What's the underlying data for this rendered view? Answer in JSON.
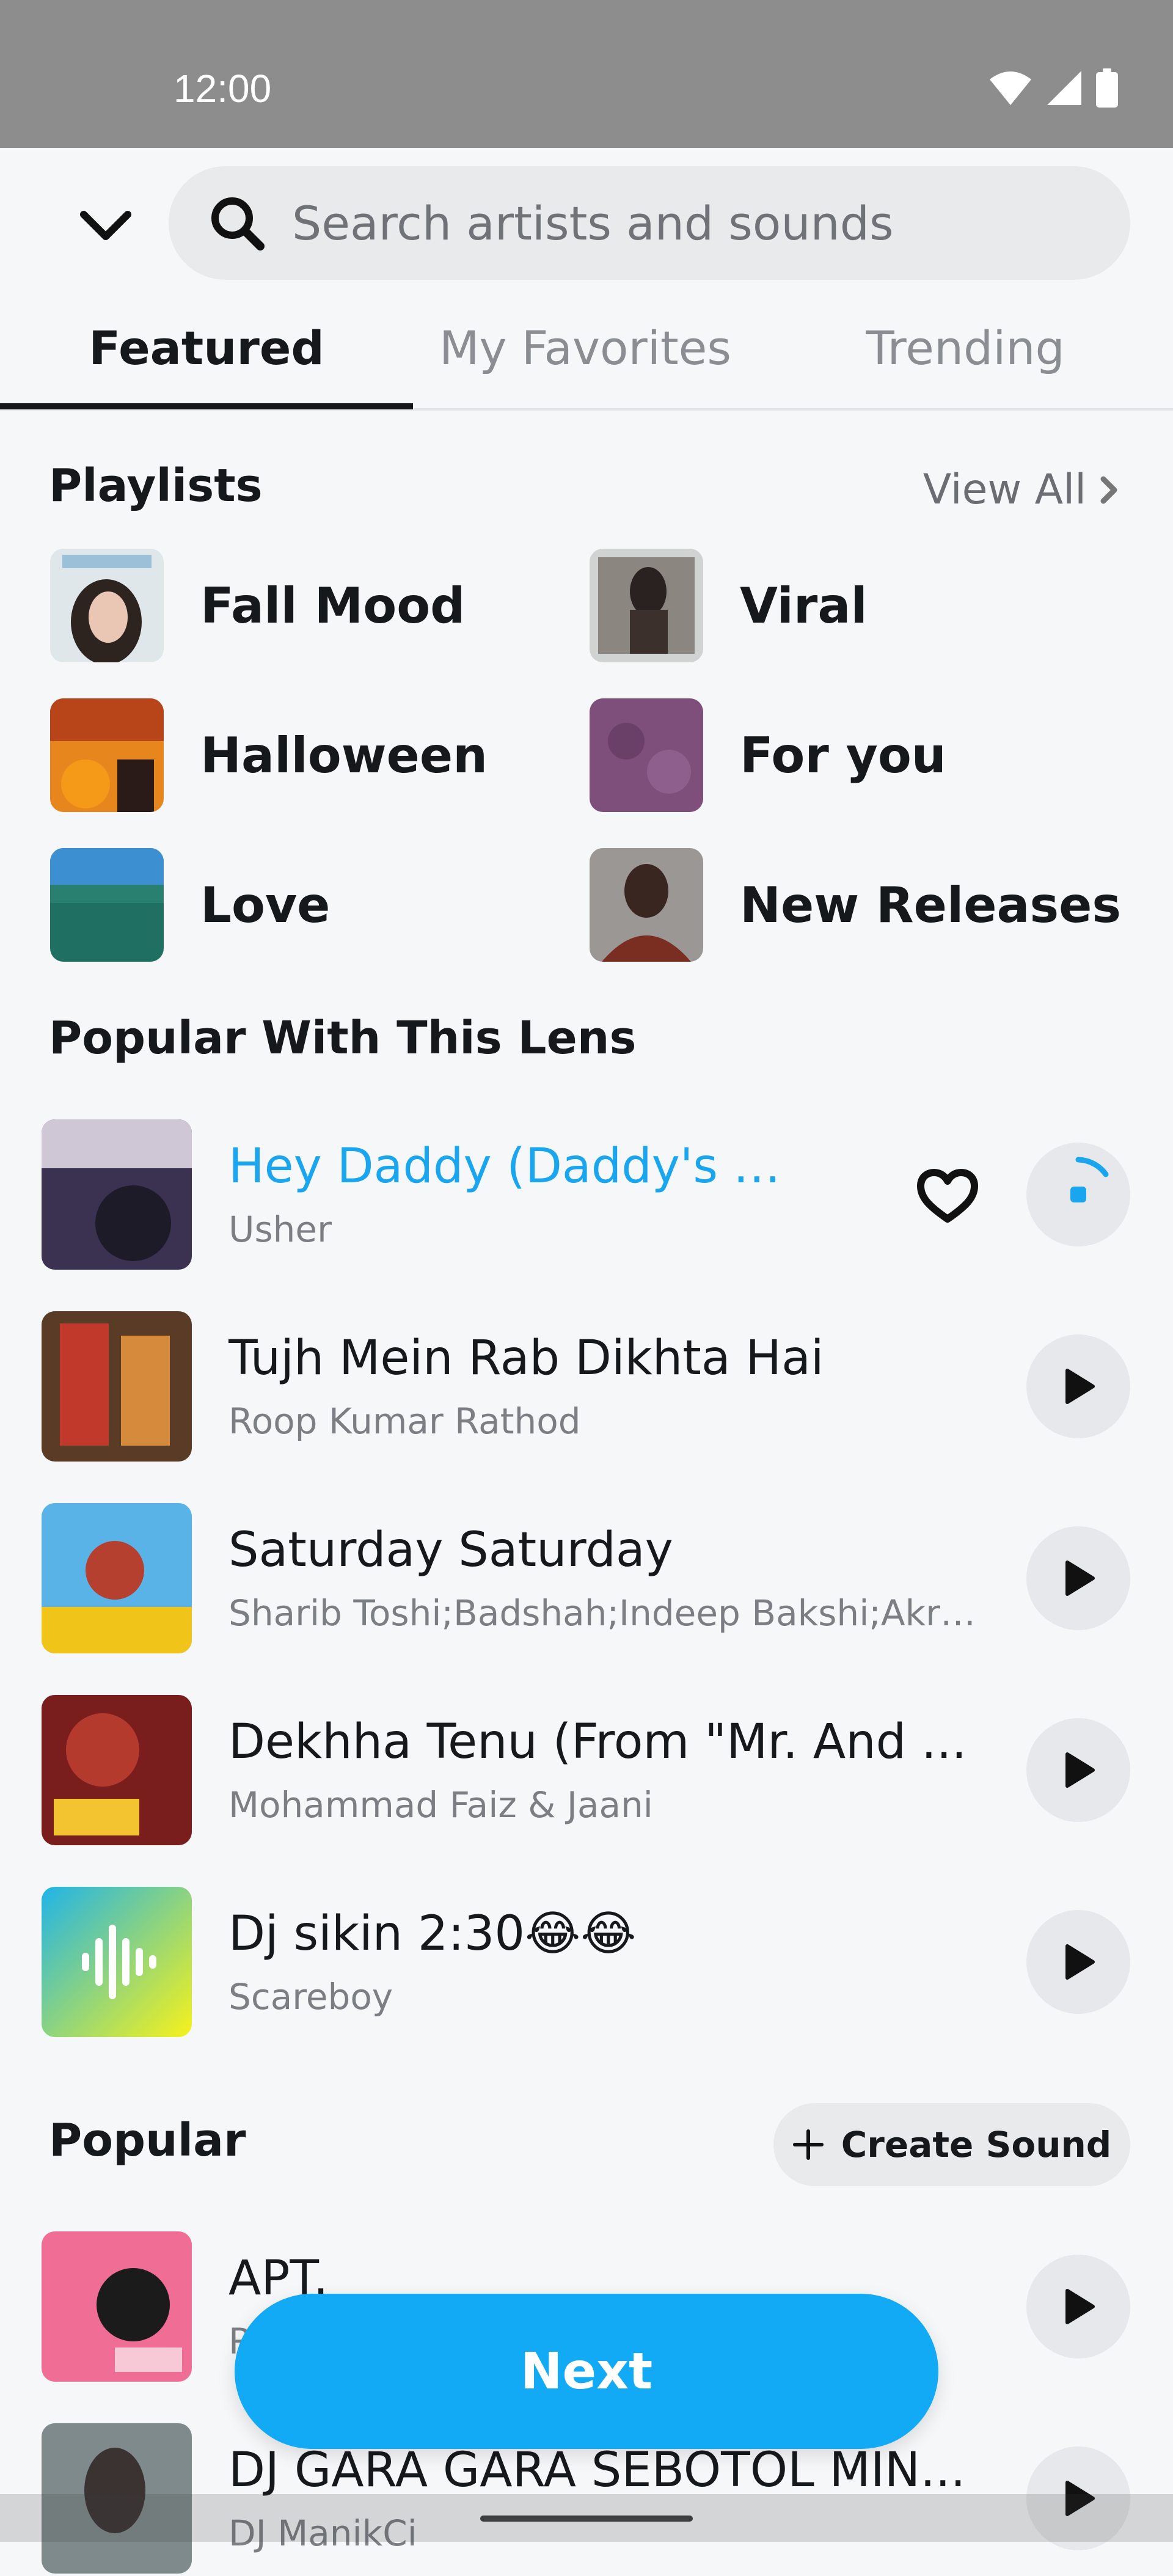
{
  "status_bar": {
    "time": "12:00"
  },
  "search": {
    "placeholder": "Search artists and sounds"
  },
  "tabs": [
    {
      "label": "Featured",
      "active": true
    },
    {
      "label": "My Favorites",
      "active": false
    },
    {
      "label": "Trending",
      "active": false
    }
  ],
  "playlists_section": {
    "title": "Playlists",
    "view_all": "View All",
    "items": [
      {
        "label": "Fall Mood"
      },
      {
        "label": "Viral"
      },
      {
        "label": "Halloween"
      },
      {
        "label": "For you"
      },
      {
        "label": "Love"
      },
      {
        "label": "New Releases"
      }
    ]
  },
  "lens_section": {
    "title": "Popular With This Lens",
    "tracks": [
      {
        "title": "Hey Daddy (Daddy's Ho...",
        "artist": "Usher",
        "state": "loading"
      },
      {
        "title": "Tujh Mein Rab Dikhta Hai",
        "artist": "Roop Kumar Rathod",
        "state": "paused"
      },
      {
        "title": "Saturday Saturday",
        "artist": "Sharib Toshi;Badshah;Indeep Bakshi;Akriti ...",
        "state": "paused"
      },
      {
        "title": "Dekhha Tenu (From \"Mr. And ...",
        "artist": "Mohammad Faiz & Jaani",
        "state": "paused"
      },
      {
        "title": "Dj sikin 2:30😂😂",
        "artist": "Scareboy",
        "state": "paused"
      }
    ]
  },
  "popular_section": {
    "title": "Popular",
    "create_sound": "Create Sound",
    "tracks": [
      {
        "title": "APT.",
        "artist": "R"
      },
      {
        "title": "DJ GARA GARA SEBOTOL MIN...",
        "artist": "DJ ManikCi"
      }
    ]
  },
  "next_button": "Next",
  "colors": {
    "accent": "#12aaf5",
    "playing_title": "#1aa5ef"
  }
}
